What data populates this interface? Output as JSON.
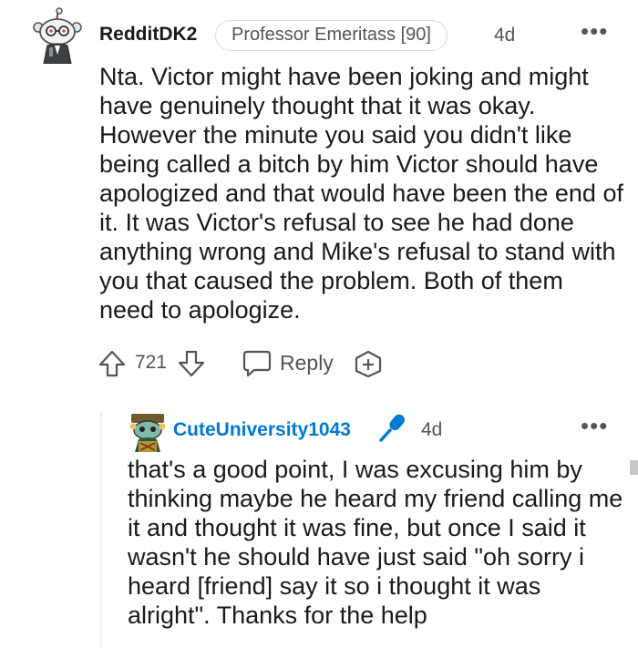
{
  "parent_comment": {
    "author": "RedditDK2",
    "flair": "Professor Emeritass [90]",
    "time": "4d",
    "more_label": "•••",
    "body": "Nta. Victor might have been joking and might have genuinely thought that it was okay. However the minute you said you didn't like being called a bitch by him Victor should have apologized and that would have been the end of it. It was Victor's refusal to see he had done anything wrong and Mike's refusal to stand with you that caused the problem. Both of them need to apologize.",
    "score": "721",
    "reply_label": "Reply",
    "avatar_icon": "snoo-avatar-icon"
  },
  "reply_comment": {
    "author": "CuteUniversity1043",
    "time": "4d",
    "more_label": "•••",
    "body": "that's a good point, I was excusing him by thinking maybe he heard my friend calling me it and thought it was fine, but once I said it wasn't he should have just said \"oh sorry i heard [friend] say it so i thought it was alright\". Thanks for the help",
    "badge_icon": "microphone-icon",
    "avatar_icon": "snoo-avatar-icon"
  },
  "colors": {
    "text": "#1a1a1b",
    "meta": "#555555",
    "op_author": "#0079d3",
    "mic_badge": "#0079d3",
    "thread_line": "#edeff1"
  }
}
